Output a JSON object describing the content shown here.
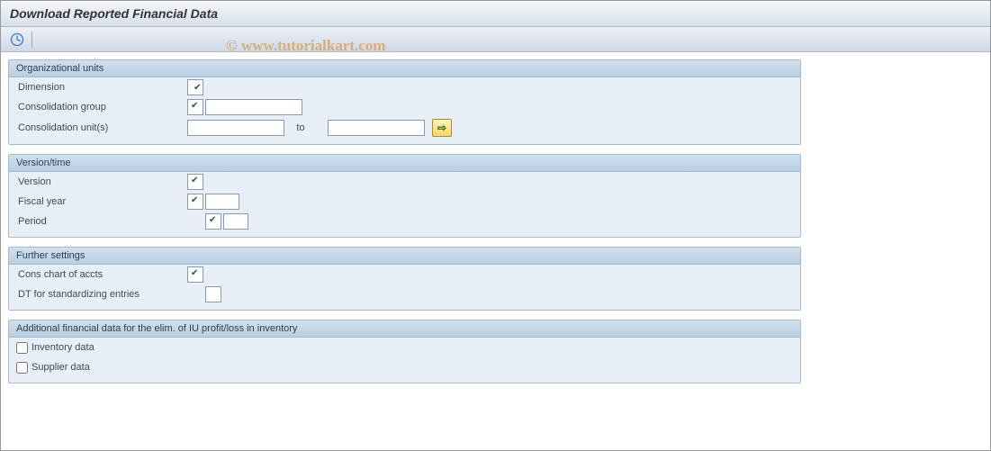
{
  "title": "Download Reported Financial Data",
  "watermark": "© www.tutorialkart.com",
  "groups": {
    "org": {
      "header": "Organizational units",
      "dimension_label": "Dimension",
      "cons_group_label": "Consolidation group",
      "cons_unit_label": "Consolidation unit(s)",
      "to_label": "to",
      "dimension_value": "",
      "cons_group_value": "",
      "cons_unit_from": "",
      "cons_unit_to": ""
    },
    "version": {
      "header": "Version/time",
      "version_label": "Version",
      "fiscal_year_label": "Fiscal year",
      "period_label": "Period",
      "version_value": "",
      "fiscal_year_value": "",
      "period_value": ""
    },
    "further": {
      "header": "Further settings",
      "coa_label": "Cons chart of accts",
      "dt_label": "DT for standardizing entries",
      "coa_value": "",
      "dt_value": ""
    },
    "additional": {
      "header": "Additional financial data for the elim. of IU profit/loss in inventory",
      "inventory_label": "Inventory data",
      "supplier_label": "Supplier data"
    }
  }
}
